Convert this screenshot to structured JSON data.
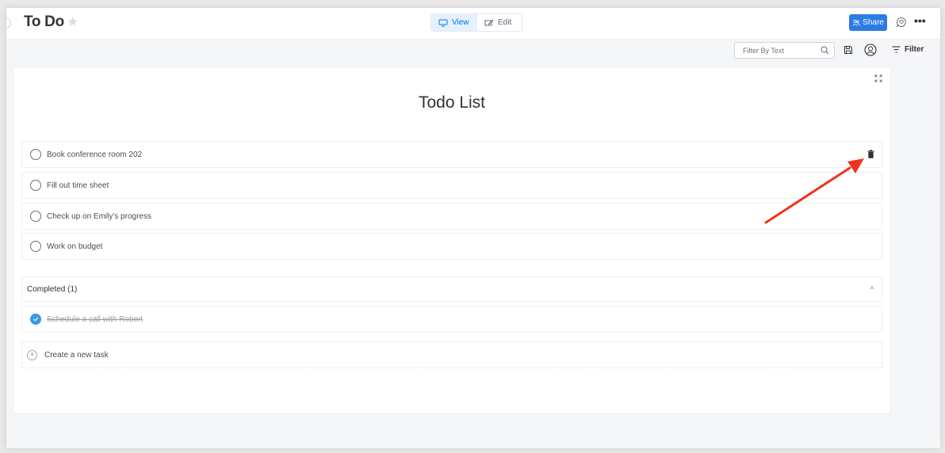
{
  "header": {
    "title": "To Do",
    "view_label": "View",
    "edit_label": "Edit",
    "share_label": "Share"
  },
  "toolbar": {
    "filter_placeholder": "Filter By Text",
    "filter_value": "",
    "filter_label": "Filter"
  },
  "card": {
    "title": "Todo List",
    "tasks": [
      {
        "label": "Book conference room 202",
        "done": false
      },
      {
        "label": "Fill out time sheet",
        "done": false
      },
      {
        "label": "Check up on Emily's progress",
        "done": false
      },
      {
        "label": "Work on budget",
        "done": false
      }
    ],
    "completed_label": "Completed (1)",
    "completed": [
      {
        "label": "Schedule a call with Robert",
        "done": true
      }
    ],
    "create_label": "Create a new task"
  },
  "colors": {
    "accent": "#0073ea",
    "share_bg": "#2c7be5",
    "check_done": "#3a98e8",
    "annotation_arrow": "#f0321e"
  }
}
